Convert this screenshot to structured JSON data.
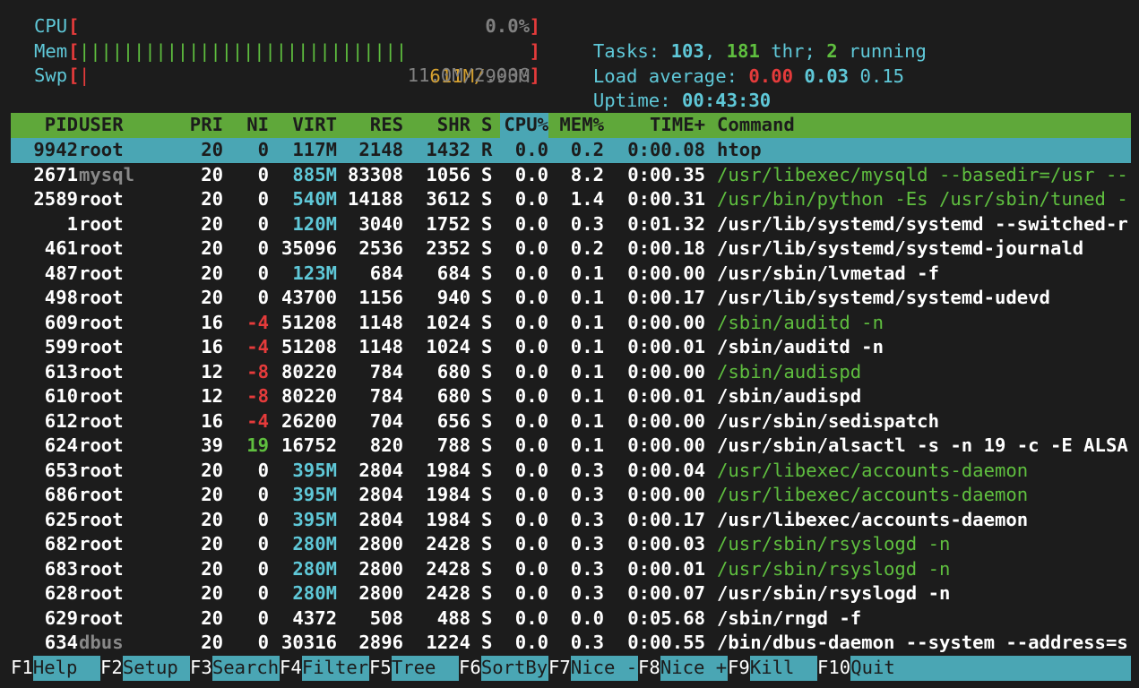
{
  "meters": {
    "cpu": {
      "label": "CPU",
      "value": "0.0%"
    },
    "mem": {
      "label": "Mem",
      "bar": "||||||||||||||||||||||||||||||",
      "value_used": "611M",
      "sep": "/",
      "value_total": "993M"
    },
    "swp": {
      "label": "Swp",
      "bar": "|",
      "value": "11.0M/2.00G"
    }
  },
  "summary": {
    "tasks_label": "Tasks:",
    "tasks": "103",
    "threads": "181",
    "thr_label": "thr;",
    "running": "2",
    "running_label": "running",
    "load_label": "Load average:",
    "load1": "0.00",
    "load5": "0.03",
    "load15": "0.15",
    "uptime_label": "Uptime:",
    "uptime": "00:43:30"
  },
  "columns": [
    "PID",
    "USER",
    "PRI",
    "NI",
    "VIRT",
    "RES",
    "SHR",
    "S",
    "CPU%",
    "MEM%",
    "TIME+",
    "Command"
  ],
  "processes": [
    {
      "pid": "9942",
      "user": "root",
      "pri": "20",
      "ni": "0",
      "virt": "117M",
      "res": "2148",
      "shr": "1432",
      "s": "R",
      "cpu": "0.0",
      "mem": "0.2",
      "time": "0:00.08",
      "cmd": "htop",
      "selected": true
    },
    {
      "pid": "2671",
      "user": "mysql",
      "pri": "20",
      "ni": "0",
      "virt": "885M",
      "res": "83308",
      "shr": "1056",
      "s": "S",
      "cpu": "0.0",
      "mem": "8.2",
      "time": "0:00.35",
      "cmd": "/usr/libexec/mysqld --basedir=/usr --"
    },
    {
      "pid": "2589",
      "user": "root",
      "pri": "20",
      "ni": "0",
      "virt": "540M",
      "res": "14188",
      "shr": "3612",
      "s": "S",
      "cpu": "0.0",
      "mem": "1.4",
      "time": "0:00.31",
      "cmd": "/usr/bin/python -Es /usr/sbin/tuned -"
    },
    {
      "pid": "1",
      "user": "root",
      "pri": "20",
      "ni": "0",
      "virt": "120M",
      "res": "3040",
      "shr": "1752",
      "s": "S",
      "cpu": "0.0",
      "mem": "0.3",
      "time": "0:01.32",
      "cmd": "/usr/lib/systemd/systemd --switched-r"
    },
    {
      "pid": "461",
      "user": "root",
      "pri": "20",
      "ni": "0",
      "virt": "35096",
      "res": "2536",
      "shr": "2352",
      "s": "S",
      "cpu": "0.0",
      "mem": "0.2",
      "time": "0:00.18",
      "cmd": "/usr/lib/systemd/systemd-journald"
    },
    {
      "pid": "487",
      "user": "root",
      "pri": "20",
      "ni": "0",
      "virt": "123M",
      "res": "684",
      "shr": "684",
      "s": "S",
      "cpu": "0.0",
      "mem": "0.1",
      "time": "0:00.00",
      "cmd": "/usr/sbin/lvmetad -f"
    },
    {
      "pid": "498",
      "user": "root",
      "pri": "20",
      "ni": "0",
      "virt": "43700",
      "res": "1156",
      "shr": "940",
      "s": "S",
      "cpu": "0.0",
      "mem": "0.1",
      "time": "0:00.17",
      "cmd": "/usr/lib/systemd/systemd-udevd"
    },
    {
      "pid": "609",
      "user": "root",
      "pri": "16",
      "ni": "-4",
      "virt": "51208",
      "res": "1148",
      "shr": "1024",
      "s": "S",
      "cpu": "0.0",
      "mem": "0.1",
      "time": "0:00.00",
      "cmd": "/sbin/auditd -n"
    },
    {
      "pid": "599",
      "user": "root",
      "pri": "16",
      "ni": "-4",
      "virt": "51208",
      "res": "1148",
      "shr": "1024",
      "s": "S",
      "cpu": "0.0",
      "mem": "0.1",
      "time": "0:00.01",
      "cmd": "/sbin/auditd -n"
    },
    {
      "pid": "613",
      "user": "root",
      "pri": "12",
      "ni": "-8",
      "virt": "80220",
      "res": "784",
      "shr": "680",
      "s": "S",
      "cpu": "0.0",
      "mem": "0.1",
      "time": "0:00.00",
      "cmd": "/sbin/audispd"
    },
    {
      "pid": "610",
      "user": "root",
      "pri": "12",
      "ni": "-8",
      "virt": "80220",
      "res": "784",
      "shr": "680",
      "s": "S",
      "cpu": "0.0",
      "mem": "0.1",
      "time": "0:00.01",
      "cmd": "/sbin/audispd"
    },
    {
      "pid": "612",
      "user": "root",
      "pri": "16",
      "ni": "-4",
      "virt": "26200",
      "res": "704",
      "shr": "656",
      "s": "S",
      "cpu": "0.0",
      "mem": "0.1",
      "time": "0:00.00",
      "cmd": "/usr/sbin/sedispatch"
    },
    {
      "pid": "624",
      "user": "root",
      "pri": "39",
      "ni": "19",
      "virt": "16752",
      "res": "820",
      "shr": "788",
      "s": "S",
      "cpu": "0.0",
      "mem": "0.1",
      "time": "0:00.00",
      "cmd": "/usr/sbin/alsactl -s -n 19 -c -E ALSA"
    },
    {
      "pid": "653",
      "user": "root",
      "pri": "20",
      "ni": "0",
      "virt": "395M",
      "res": "2804",
      "shr": "1984",
      "s": "S",
      "cpu": "0.0",
      "mem": "0.3",
      "time": "0:00.04",
      "cmd": "/usr/libexec/accounts-daemon"
    },
    {
      "pid": "686",
      "user": "root",
      "pri": "20",
      "ni": "0",
      "virt": "395M",
      "res": "2804",
      "shr": "1984",
      "s": "S",
      "cpu": "0.0",
      "mem": "0.3",
      "time": "0:00.00",
      "cmd": "/usr/libexec/accounts-daemon"
    },
    {
      "pid": "625",
      "user": "root",
      "pri": "20",
      "ni": "0",
      "virt": "395M",
      "res": "2804",
      "shr": "1984",
      "s": "S",
      "cpu": "0.0",
      "mem": "0.3",
      "time": "0:00.17",
      "cmd": "/usr/libexec/accounts-daemon"
    },
    {
      "pid": "682",
      "user": "root",
      "pri": "20",
      "ni": "0",
      "virt": "280M",
      "res": "2800",
      "shr": "2428",
      "s": "S",
      "cpu": "0.0",
      "mem": "0.3",
      "time": "0:00.03",
      "cmd": "/usr/sbin/rsyslogd -n"
    },
    {
      "pid": "683",
      "user": "root",
      "pri": "20",
      "ni": "0",
      "virt": "280M",
      "res": "2800",
      "shr": "2428",
      "s": "S",
      "cpu": "0.0",
      "mem": "0.3",
      "time": "0:00.01",
      "cmd": "/usr/sbin/rsyslogd -n"
    },
    {
      "pid": "628",
      "user": "root",
      "pri": "20",
      "ni": "0",
      "virt": "280M",
      "res": "2800",
      "shr": "2428",
      "s": "S",
      "cpu": "0.0",
      "mem": "0.3",
      "time": "0:00.07",
      "cmd": "/usr/sbin/rsyslogd -n"
    },
    {
      "pid": "629",
      "user": "root",
      "pri": "20",
      "ni": "0",
      "virt": "4372",
      "res": "508",
      "shr": "488",
      "s": "S",
      "cpu": "0.0",
      "mem": "0.0",
      "time": "0:05.68",
      "cmd": "/sbin/rngd -f"
    },
    {
      "pid": "634",
      "user": "dbus",
      "pri": "20",
      "ni": "0",
      "virt": "30316",
      "res": "2896",
      "shr": "1224",
      "s": "S",
      "cpu": "0.0",
      "mem": "0.3",
      "time": "0:00.55",
      "cmd": "/bin/dbus-daemon --system --address=s"
    }
  ],
  "function_keys": [
    {
      "key": "F1",
      "label": "Help"
    },
    {
      "key": "F2",
      "label": "Setup"
    },
    {
      "key": "F3",
      "label": "Search"
    },
    {
      "key": "F4",
      "label": "Filter"
    },
    {
      "key": "F5",
      "label": "Tree"
    },
    {
      "key": "F6",
      "label": "SortBy"
    },
    {
      "key": "F7",
      "label": "Nice -"
    },
    {
      "key": "F8",
      "label": "Nice +"
    },
    {
      "key": "F9",
      "label": "Kill"
    },
    {
      "key": "F10",
      "label": "Quit"
    }
  ],
  "colors": {
    "background": "#1c1c1c",
    "header_bar": "#5fa83a",
    "selection": "#4aa6b4",
    "cyan": "#5fc8d8",
    "green": "#5fbf3f",
    "red": "#e53b3b"
  }
}
